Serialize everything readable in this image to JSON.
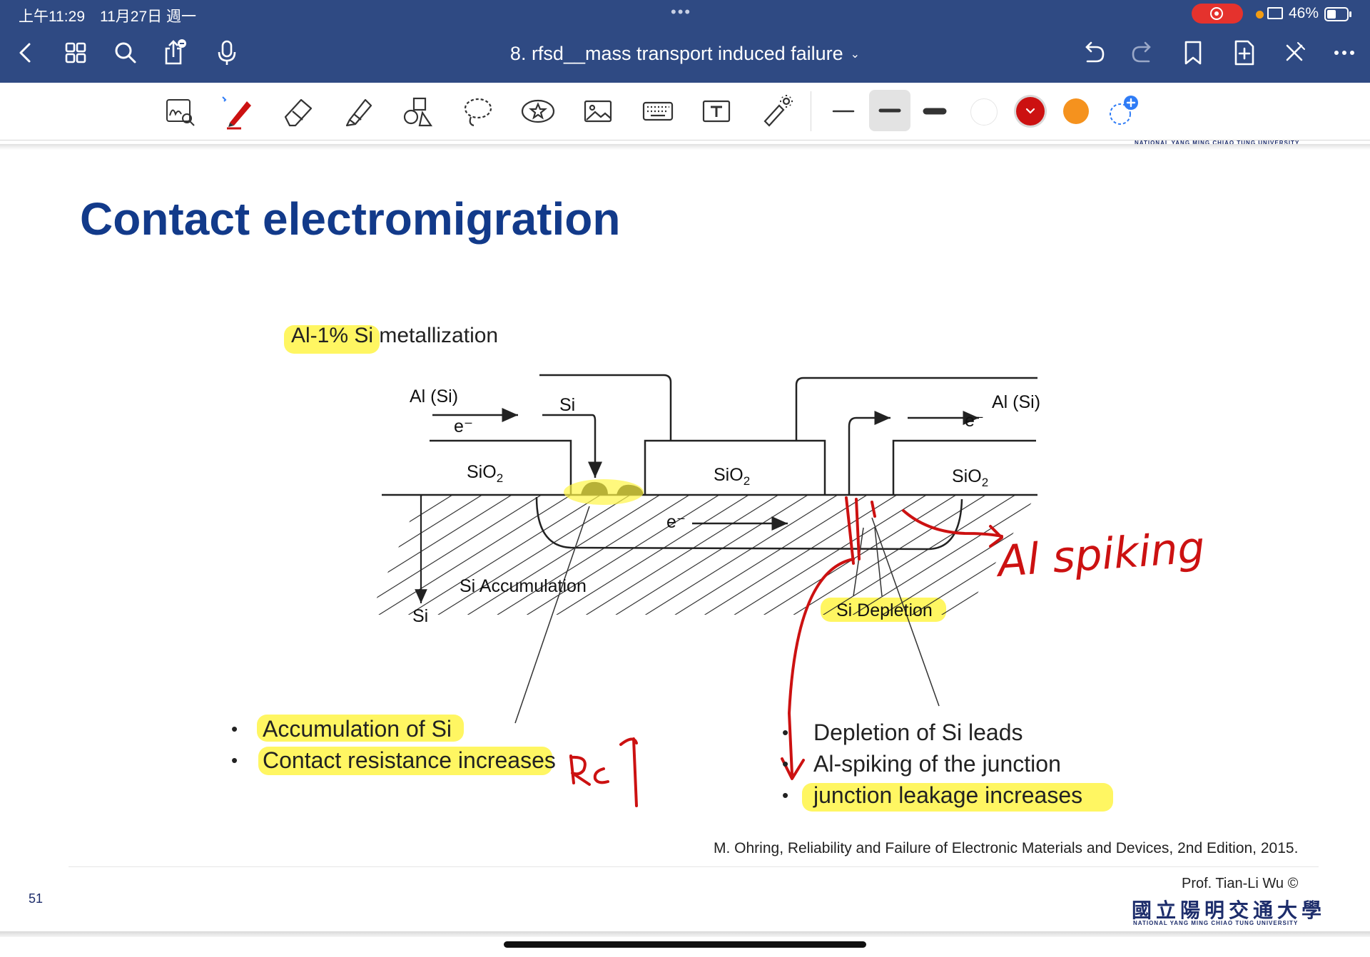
{
  "status_bar": {
    "time": "上午11:29　11月27日 週一",
    "dots": "•••",
    "battery": "46%"
  },
  "nav": {
    "title": "8. rfsd__mass transport induced failure",
    "title_caret": "⌄"
  },
  "toolbar": {
    "footer_text": "NATIONAL YANG MING CHIAO TUNG UNIVERSITY",
    "colors": {
      "black": "#222222",
      "white": "#ffffff",
      "red": "#cc1111",
      "orange": "#f5921e",
      "accent": "#2f7cf6"
    }
  },
  "slide": {
    "title": "Contact electromigration",
    "subtitle": "Al-1% Si metallization",
    "diagram": {
      "al_si_left": "Al (Si)",
      "al_si_right": "Al (Si)",
      "electron": "e⁻",
      "si": "Si",
      "sio2": "SiO",
      "sub2": "2",
      "si_accumulation": "Si Accumulation",
      "si_depletion": "Si Depletion",
      "si_bottom": "Si"
    },
    "annotations": {
      "al_spiking": "Al spiking",
      "rc": "Rc"
    },
    "left_bullets": [
      "Accumulation of Si",
      "Contact resistance increases"
    ],
    "right_bullets": [
      "Depletion of Si leads",
      "Al-spiking of the junction",
      "junction leakage increases"
    ],
    "citation": "M. Ohring, Reliability and Failure of Electronic Materials and Devices, 2nd Edition, 2015.",
    "page_number": "51",
    "prof": "Prof. Tian-Li Wu ©",
    "university_cn": "國立陽明交通大學",
    "university_en": "NATIONAL YANG MING CHIAO TUNG UNIVERSITY"
  }
}
